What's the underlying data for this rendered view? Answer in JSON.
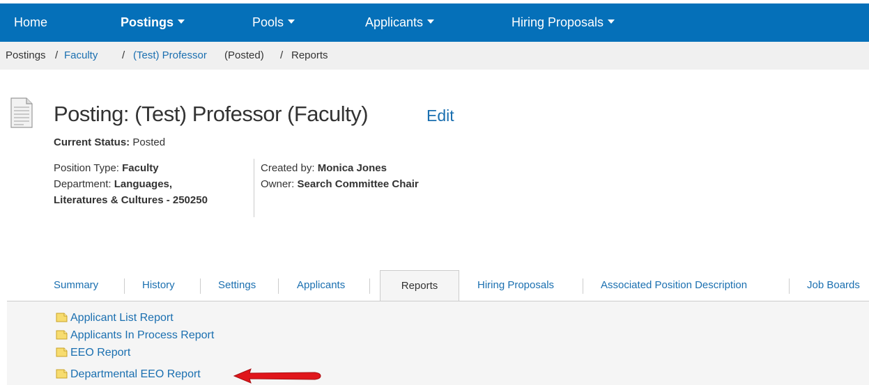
{
  "nav": {
    "items": [
      {
        "label": "Home",
        "dropdown": false
      },
      {
        "label": "Postings",
        "dropdown": true
      },
      {
        "label": "Pools",
        "dropdown": true
      },
      {
        "label": "Applicants",
        "dropdown": true
      },
      {
        "label": "Hiring Proposals",
        "dropdown": true
      }
    ]
  },
  "breadcrumb": {
    "postings": "Postings",
    "faculty": "Faculty",
    "posting": "(Test) Professor",
    "posted": "(Posted)",
    "reports": "Reports",
    "sep": "/"
  },
  "header": {
    "title": "Posting: (Test) Professor (Faculty)",
    "edit": "Edit",
    "status_label": "Current Status:",
    "status_value": "Posted"
  },
  "details": {
    "position_type_label": "Position Type:",
    "position_type_value": "Faculty",
    "department_label": "Department:",
    "department_value_1": "Languages,",
    "department_value_2": "Literatures & Cultures - 250250",
    "created_by_label": "Created by:",
    "created_by_value": "Monica Jones",
    "owner_label": "Owner:",
    "owner_value": "Search Committee Chair"
  },
  "tabs": [
    {
      "label": "Summary"
    },
    {
      "label": "History"
    },
    {
      "label": "Settings"
    },
    {
      "label": "Applicants"
    },
    {
      "label": "Reports",
      "active": true
    },
    {
      "label": "Hiring Proposals"
    },
    {
      "label": "Associated Position Description"
    },
    {
      "label": "Job Boards"
    }
  ],
  "reports": [
    {
      "label": "Applicant List Report"
    },
    {
      "label": "Applicants In Process Report"
    },
    {
      "label": "EEO Report"
    },
    {
      "label": "Departmental EEO Report"
    }
  ],
  "colors": {
    "nav_bg": "#0570b9",
    "link": "#1a6fb0",
    "arrow": "#e0161b"
  }
}
